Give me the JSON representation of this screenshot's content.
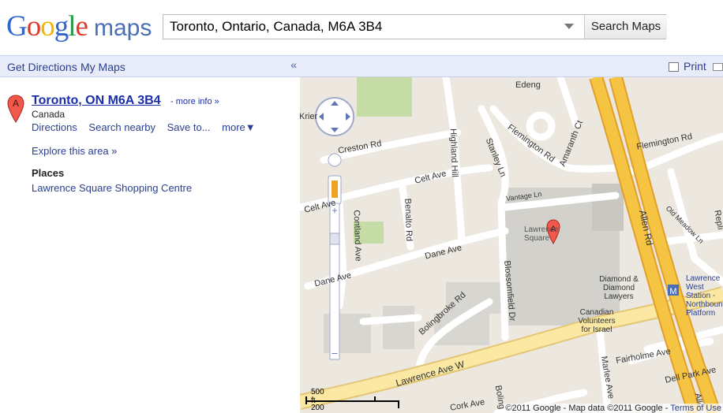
{
  "header": {
    "logo_word": "Google",
    "logo_maps": "maps",
    "search_value": "Toronto, Ontario, Canada, M6A 3B4",
    "search_button": "Search Maps"
  },
  "leftbar": {
    "get_directions": "Get Directions",
    "my_maps": "My Maps",
    "collapse": "«"
  },
  "result": {
    "marker_letter": "A",
    "title": "Toronto, ON M6A 3B4",
    "more_info": "- more info »",
    "country": "Canada",
    "actions": [
      "Directions",
      "Search nearby",
      "Save to...",
      "more▼"
    ],
    "explore": "Explore this area »",
    "places_heading": "Places",
    "places": [
      "Lawrence Square Shopping Centre"
    ]
  },
  "maptop": {
    "print": "Print"
  },
  "map": {
    "labels": {
      "edeng": "Edeng",
      "krier": "Krier",
      "creston": "Creston Rd",
      "highland": "Highland Hill",
      "flemington1": "Flemington Rd",
      "amaranth": "Amaranth Ct",
      "flemington2": "Flemington Rd",
      "stanley": "Stanley Ln",
      "celt1": "Celt Ave",
      "celt2": "Celt Ave",
      "vantage": "Vantage Ln",
      "benalto": "Benalto Rd",
      "contland": "Contland Ave",
      "lawrence_sq": "Lawrence Square",
      "dane1": "Dane Ave",
      "dane2": "Dane Ave",
      "allen": "Allen Rd",
      "old_meadow": "Old Meadow Ln",
      "repl": "Repli",
      "bolingbroke": "Bolingbroke Rd",
      "blossomfield": "Blossomfield Dr",
      "diamond": "Diamond & Diamond Lawyers",
      "canadian": "Canadian Volunteers for Israel",
      "lawrence_w": "Lawrence Ave W",
      "fairholme": "Fairholme Ave",
      "marlee": "Marlee Ave",
      "dell_park": "Dell Park Ave",
      "cork": "Cork Ave",
      "boling": "Boling",
      "station": "Lawrence West Station - Northbound Platform",
      "alle": "Alle"
    },
    "scale_ft": "500 ft",
    "scale_m": "200 m",
    "copyright": "©2011 Google - Map data ©2011 Google - ",
    "terms": "Terms of Use"
  },
  "colors": {
    "link": "#2a3f8f",
    "highway": "#f6c443",
    "bar": "#e8ecf9"
  }
}
